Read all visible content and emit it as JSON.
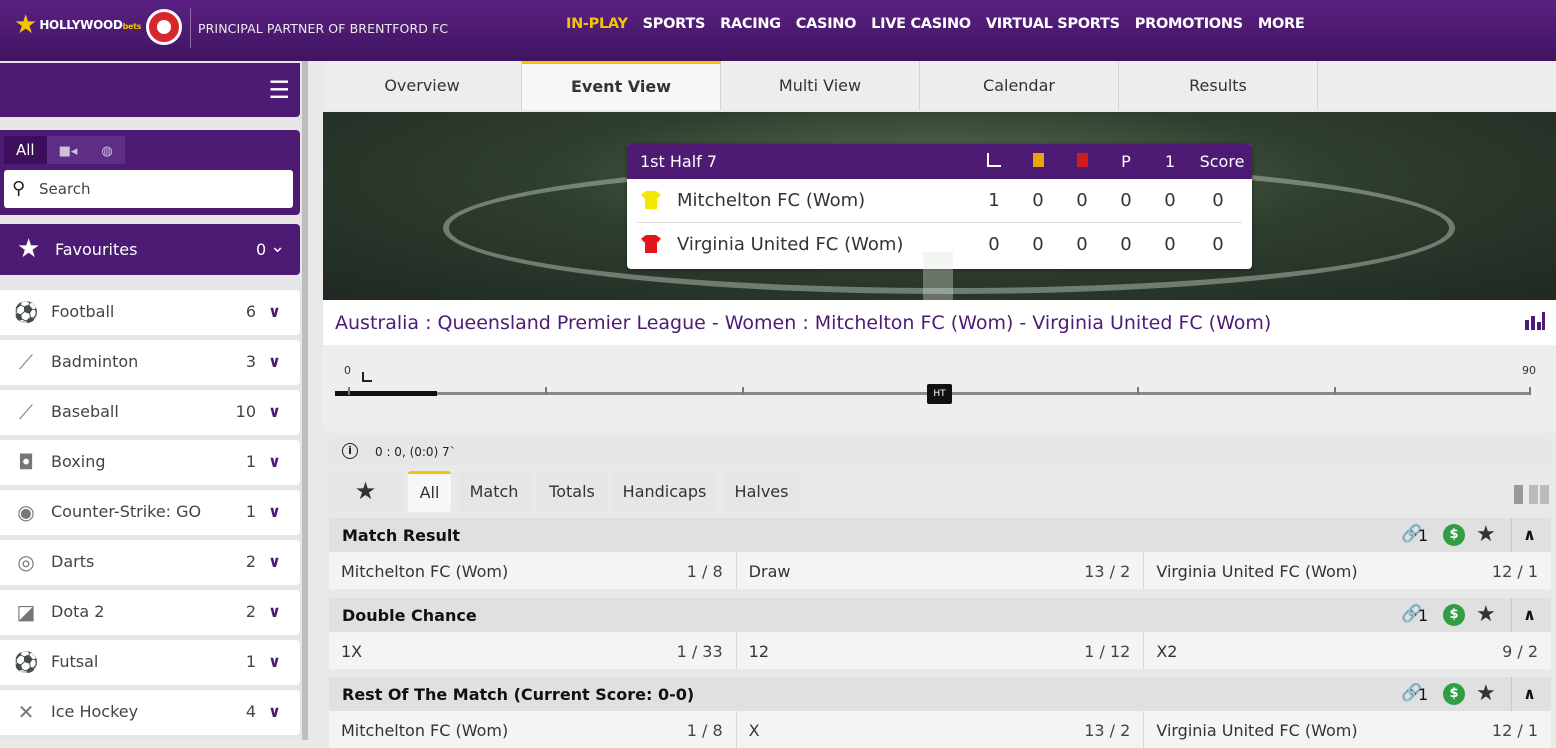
{
  "header": {
    "brand_main": "HOLLYWOOD",
    "brand_suffix": "bets",
    "partner": "PRINCIPAL PARTNER OF BRENTFORD FC",
    "nav": [
      "IN-PLAY",
      "SPORTS",
      "RACING",
      "CASINO",
      "LIVE CASINO",
      "VIRTUAL SPORTS",
      "PROMOTIONS",
      "MORE"
    ],
    "active_nav": "IN-PLAY",
    "accent_color": "#f4c400",
    "brand_color": "#4d1a74"
  },
  "sidebar": {
    "filter_tabs": [
      "All",
      "video-icon",
      "globe-icon"
    ],
    "search_placeholder": "Search",
    "favourites": {
      "label": "Favourites",
      "count": "0"
    },
    "sports": [
      {
        "name": "Football",
        "count": "6",
        "icon": "football-icon"
      },
      {
        "name": "Badminton",
        "count": "3",
        "icon": "shuttlecock-icon"
      },
      {
        "name": "Baseball",
        "count": "10",
        "icon": "baseball-bat-icon"
      },
      {
        "name": "Boxing",
        "count": "1",
        "icon": "boxing-gloves-icon"
      },
      {
        "name": "Counter-Strike: GO",
        "count": "1",
        "icon": "soldier-icon"
      },
      {
        "name": "Darts",
        "count": "2",
        "icon": "dartboard-icon"
      },
      {
        "name": "Dota 2",
        "count": "2",
        "icon": "dota-icon"
      },
      {
        "name": "Futsal",
        "count": "1",
        "icon": "futsal-ball-icon"
      },
      {
        "name": "Ice Hockey",
        "count": "4",
        "icon": "hockey-sticks-icon"
      }
    ]
  },
  "tabs": [
    "Overview",
    "Event View",
    "Multi View",
    "Calendar",
    "Results"
  ],
  "active_tab": "Event View",
  "scoreboard": {
    "period": "1st Half 7",
    "columns": [
      "corner-icon",
      "yellow-card-icon",
      "red-card-icon",
      "P",
      "1",
      "Score"
    ],
    "teams": [
      {
        "name": "Mitchelton FC (Wom)",
        "shirt_color": "#f5e800",
        "stats": [
          "1",
          "0",
          "0",
          "0",
          "0",
          "0"
        ]
      },
      {
        "name": "Virginia United FC (Wom)",
        "shirt_color": "#e4161b",
        "stats": [
          "0",
          "0",
          "0",
          "0",
          "0",
          "0"
        ]
      }
    ]
  },
  "event_title": "Australia : Queensland Premier League - Women : Mitchelton FC (Wom) - Virginia United FC (Wom)",
  "timeline": {
    "start": "0",
    "end": "90",
    "ht": "HT",
    "elapsed_minutes": 7
  },
  "info_text": "0 : 0, (0:0) 7`",
  "market_filters": [
    "All",
    "Match",
    "Totals",
    "Handicaps",
    "Halves"
  ],
  "active_market_filter": "All",
  "markets": [
    {
      "title": "Match Result",
      "links": "1",
      "selections": [
        {
          "name": "Mitchelton FC (Wom)",
          "price": "1 / 8"
        },
        {
          "name": "Draw",
          "price": "13 / 2"
        },
        {
          "name": "Virginia United FC (Wom)",
          "price": "12 / 1"
        }
      ]
    },
    {
      "title": "Double Chance",
      "links": "1",
      "selections": [
        {
          "name": "1X",
          "price": "1 / 33"
        },
        {
          "name": "12",
          "price": "1 / 12"
        },
        {
          "name": "X2",
          "price": "9 / 2"
        }
      ]
    },
    {
      "title": "Rest Of The Match (Current Score: 0-0)",
      "links": "1",
      "selections": [
        {
          "name": "Mitchelton FC (Wom)",
          "price": "1 / 8"
        },
        {
          "name": "X",
          "price": "13 / 2"
        },
        {
          "name": "Virginia United FC (Wom)",
          "price": "12 / 1"
        }
      ]
    }
  ]
}
